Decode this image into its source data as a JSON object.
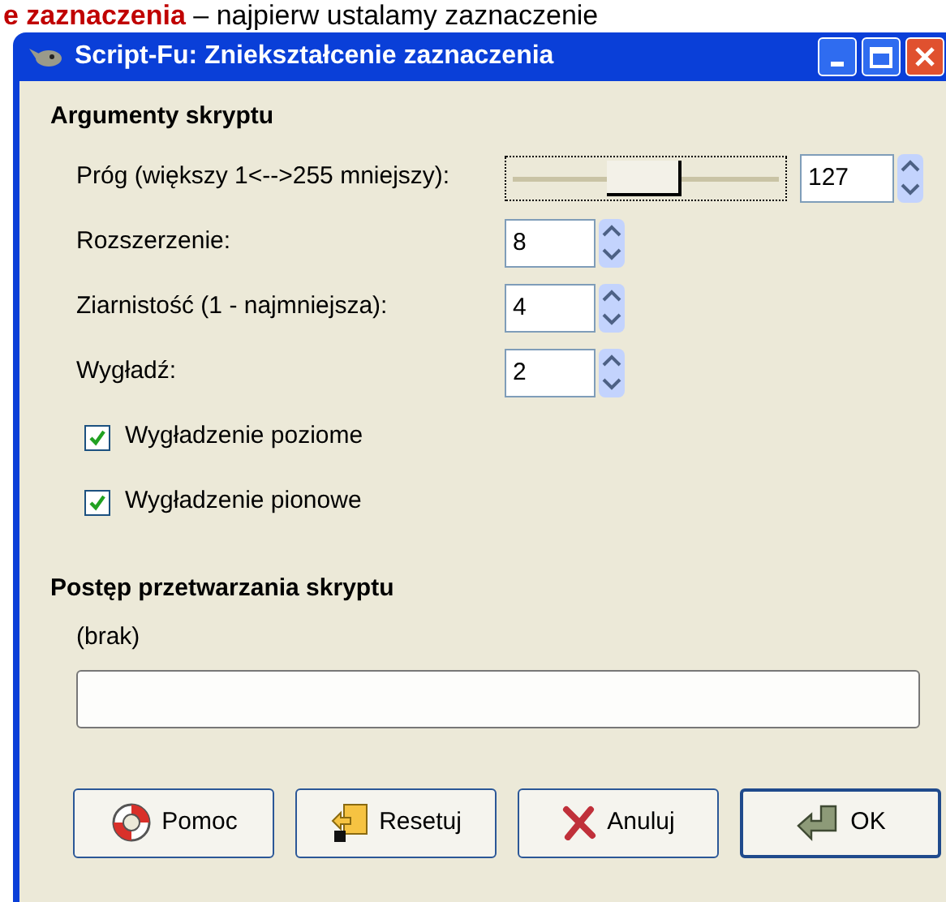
{
  "background_text": "**e zaznaczenia** – najpierw ustalamy zaznaczenie",
  "window": {
    "title": "Script-Fu: Zniekształcenie zaznaczenia"
  },
  "arguments": {
    "heading": "Argumenty skryptu",
    "fields": [
      {
        "kind": "slider",
        "label": "Próg (większy 1<-->255 mniejszy):",
        "level": 0.496,
        "value": "127"
      },
      {
        "kind": "spin",
        "label": "Rozszerzenie:",
        "value": "8"
      },
      {
        "kind": "spin",
        "label": "Ziarnistość (1 - najmniejsza):",
        "value": "4"
      },
      {
        "kind": "spin",
        "label": "Wygładź:",
        "value": "2"
      },
      {
        "kind": "checkbox",
        "label": "Wygładzenie poziome",
        "checked": true
      },
      {
        "kind": "checkbox",
        "label": "Wygładzenie pionowe",
        "checked": true
      }
    ]
  },
  "progress": {
    "heading": "Postęp przetwarzania skryptu",
    "status": "(brak)",
    "level": 0
  },
  "buttons": [
    {
      "kind": "help",
      "label": "Pomoc",
      "default": false
    },
    {
      "kind": "reset",
      "label": "Resetuj",
      "default": false
    },
    {
      "kind": "cancel",
      "label": "Anuluj",
      "default": false
    },
    {
      "kind": "ok",
      "label": "OK",
      "default": true
    }
  ]
}
